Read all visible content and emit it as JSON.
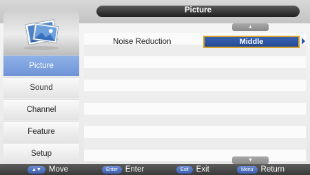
{
  "header": {
    "title": "Picture"
  },
  "sidebar": {
    "items": [
      {
        "label": "Picture",
        "active": true
      },
      {
        "label": "Sound",
        "active": false
      },
      {
        "label": "Channel",
        "active": false
      },
      {
        "label": "Feature",
        "active": false
      },
      {
        "label": "Setup",
        "active": false
      }
    ]
  },
  "content": {
    "scroll_up_glyph": "▲",
    "scroll_down_glyph": "▼",
    "settings": [
      {
        "label": "Noise Reduction",
        "value": "Middle"
      }
    ]
  },
  "footer": {
    "hints": [
      {
        "key": "▲▼",
        "label": "Move"
      },
      {
        "key": "Enter",
        "label": "Enter"
      },
      {
        "key": "Exit",
        "label": "Exit"
      },
      {
        "key": "Menu",
        "label": "Return"
      }
    ]
  },
  "colors": {
    "accent": "#3a62ae",
    "highlight_border": "#d9a42a",
    "active_item": "#7fa4e0"
  }
}
